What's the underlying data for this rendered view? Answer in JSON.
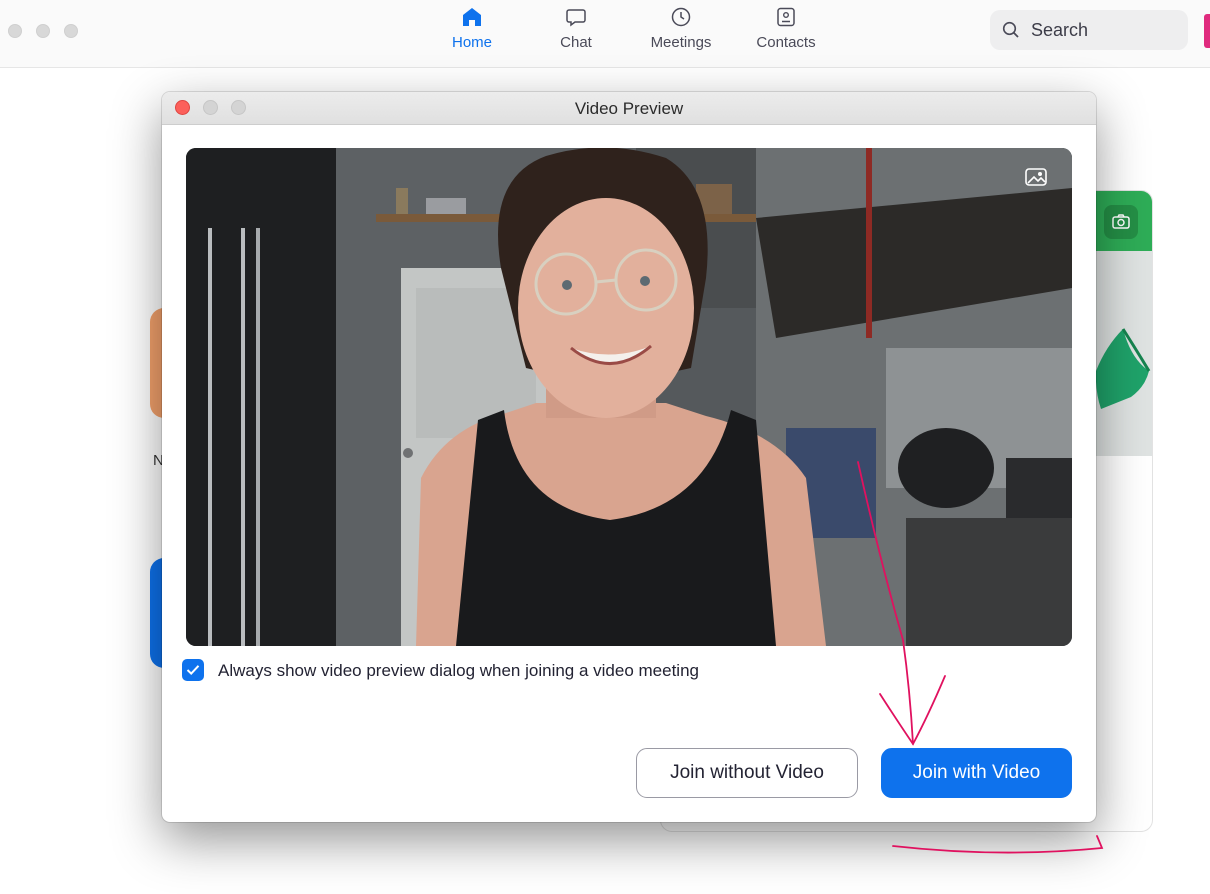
{
  "app": {
    "nav": [
      {
        "label": "Home",
        "icon": "home-icon",
        "active": true
      },
      {
        "label": "Chat",
        "icon": "chat-icon",
        "active": false
      },
      {
        "label": "Meetings",
        "icon": "clock-icon",
        "active": false
      },
      {
        "label": "Contacts",
        "icon": "contact-card-icon",
        "active": false
      }
    ],
    "search": {
      "placeholder": "Search",
      "icon": "search-icon"
    },
    "background_letter": "N"
  },
  "dialog": {
    "title": "Video Preview",
    "video": {
      "description_icon": "background-picker-icon"
    },
    "checkbox": {
      "label": "Always show video preview dialog when joining a video meeting",
      "checked": true
    },
    "buttons": {
      "join_without_video": "Join without Video",
      "join_with_video": "Join with Video"
    }
  },
  "colors": {
    "accent": "#0e72ed",
    "close": "#fc605b",
    "annotation": "#e0115f"
  }
}
